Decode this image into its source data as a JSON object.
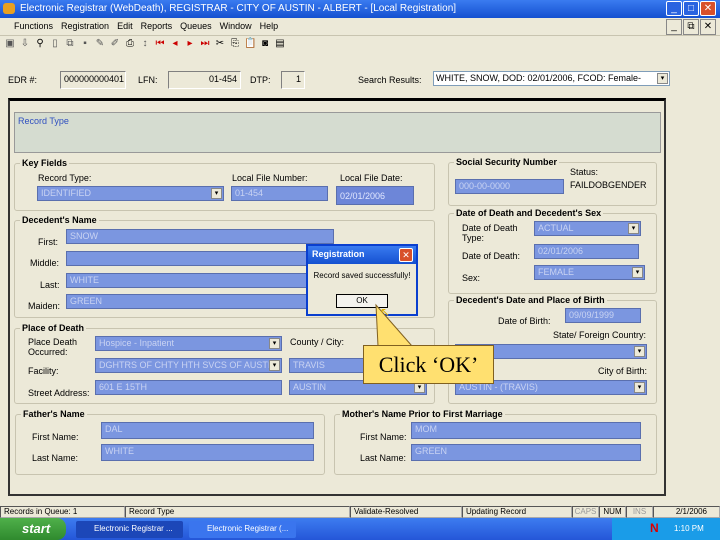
{
  "window": {
    "title": "Electronic Registrar (WebDeath), REGISTRAR - CITY OF AUSTIN - ALBERT - [Local Registration]"
  },
  "menu": [
    "Functions",
    "Registration",
    "Edit",
    "Reports",
    "Queues",
    "Window",
    "Help"
  ],
  "toolbar_icons": [
    "new-icon",
    "exit-icon",
    "find-icon",
    "document-icon",
    "copy-icon",
    "save-icon",
    "sign-icon",
    "edit-icon",
    "print-icon",
    "refresh-icon",
    "first-icon",
    "prev-icon",
    "next-icon",
    "last-icon",
    "cut-icon",
    "copy-icon",
    "paste-icon",
    "help-icon",
    "info-icon"
  ],
  "header": {
    "edr_label": "EDR #:",
    "edr": "000000000401",
    "lfn_label": "LFN:",
    "lfn": "01-454",
    "dtp_label": "DTP:",
    "dtp": "1",
    "search_label": "Search Results:",
    "search_value": "WHITE, SNOW, DOD: 02/01/2006, FCOD: Female-"
  },
  "record_type_panel": "Record Type",
  "key_fields": {
    "title": "Key Fields",
    "record_type_label": "Record Type:",
    "record_type": "IDENTIFIED",
    "lfn_label": "Local File Number:",
    "lfn": "01-454",
    "lfd_label": "Local File Date:",
    "lfd": "02/01/2006"
  },
  "name": {
    "title": "Decedent's Name",
    "first_label": "First:",
    "first": "SNOW",
    "middle_label": "Middle:",
    "middle": "",
    "last_label": "Last:",
    "last": "WHITE",
    "maiden_label": "Maiden:",
    "maiden": "GREEN"
  },
  "place": {
    "title": "Place of Death",
    "occurred_label": "Place Death Occurred:",
    "occurred": "Hospice - Inpatient",
    "facility_label": "Facility:",
    "facility": "DGHTRS OF CHTY HTH SVCS OF AUSTI",
    "street_label": "Street Address:",
    "street": "601 E 15TH",
    "county_label": "County / City:",
    "county": "TRAVIS",
    "city": "AUSTIN"
  },
  "ssn": {
    "title": "Social Security Number",
    "ssn": "000-00-0000",
    "status_label": "Status:",
    "status": "FAILDOBGENDER"
  },
  "dod": {
    "title": "Date of Death and Decedent's Sex",
    "type_label": "Date of Death Type:",
    "type": "ACTUAL",
    "date_label": "Date of Death:",
    "date": "02/01/2006",
    "sex_label": "Sex:",
    "sex": "FEMALE"
  },
  "birth": {
    "title": "Decedent's Date and Place of Birth",
    "dob_label": "Date of Birth:",
    "dob": "09/09/1999",
    "state_label": "State/ Foreign Country:",
    "state": "",
    "city_label": "City of Birth:",
    "city": "AUSTIN - (TRAVIS)"
  },
  "father": {
    "title": "Father's Name",
    "first_label": "First Name:",
    "first": "DAL",
    "last_label": "Last Name:",
    "last": "WHITE"
  },
  "mother": {
    "title": "Mother's Name Prior to First Marriage",
    "first_label": "First Name:",
    "first": "MOM",
    "last_label": "Last Name:",
    "last": "GREEN"
  },
  "dialog": {
    "title": "Registration",
    "message": "Record saved successfully!",
    "ok": "OK"
  },
  "callout": "Click ‘OK’",
  "statusbar": [
    "Records in Queue: 1",
    "Record Type",
    "Validate-Resolved",
    "Updating Record",
    "CAPS",
    "NUM",
    "INS",
    "2/1/2006"
  ],
  "taskbar": {
    "start": "start",
    "items": [
      "Electronic Registrar ...",
      "Electronic Registrar (..."
    ],
    "clock": "1:10 PM"
  }
}
